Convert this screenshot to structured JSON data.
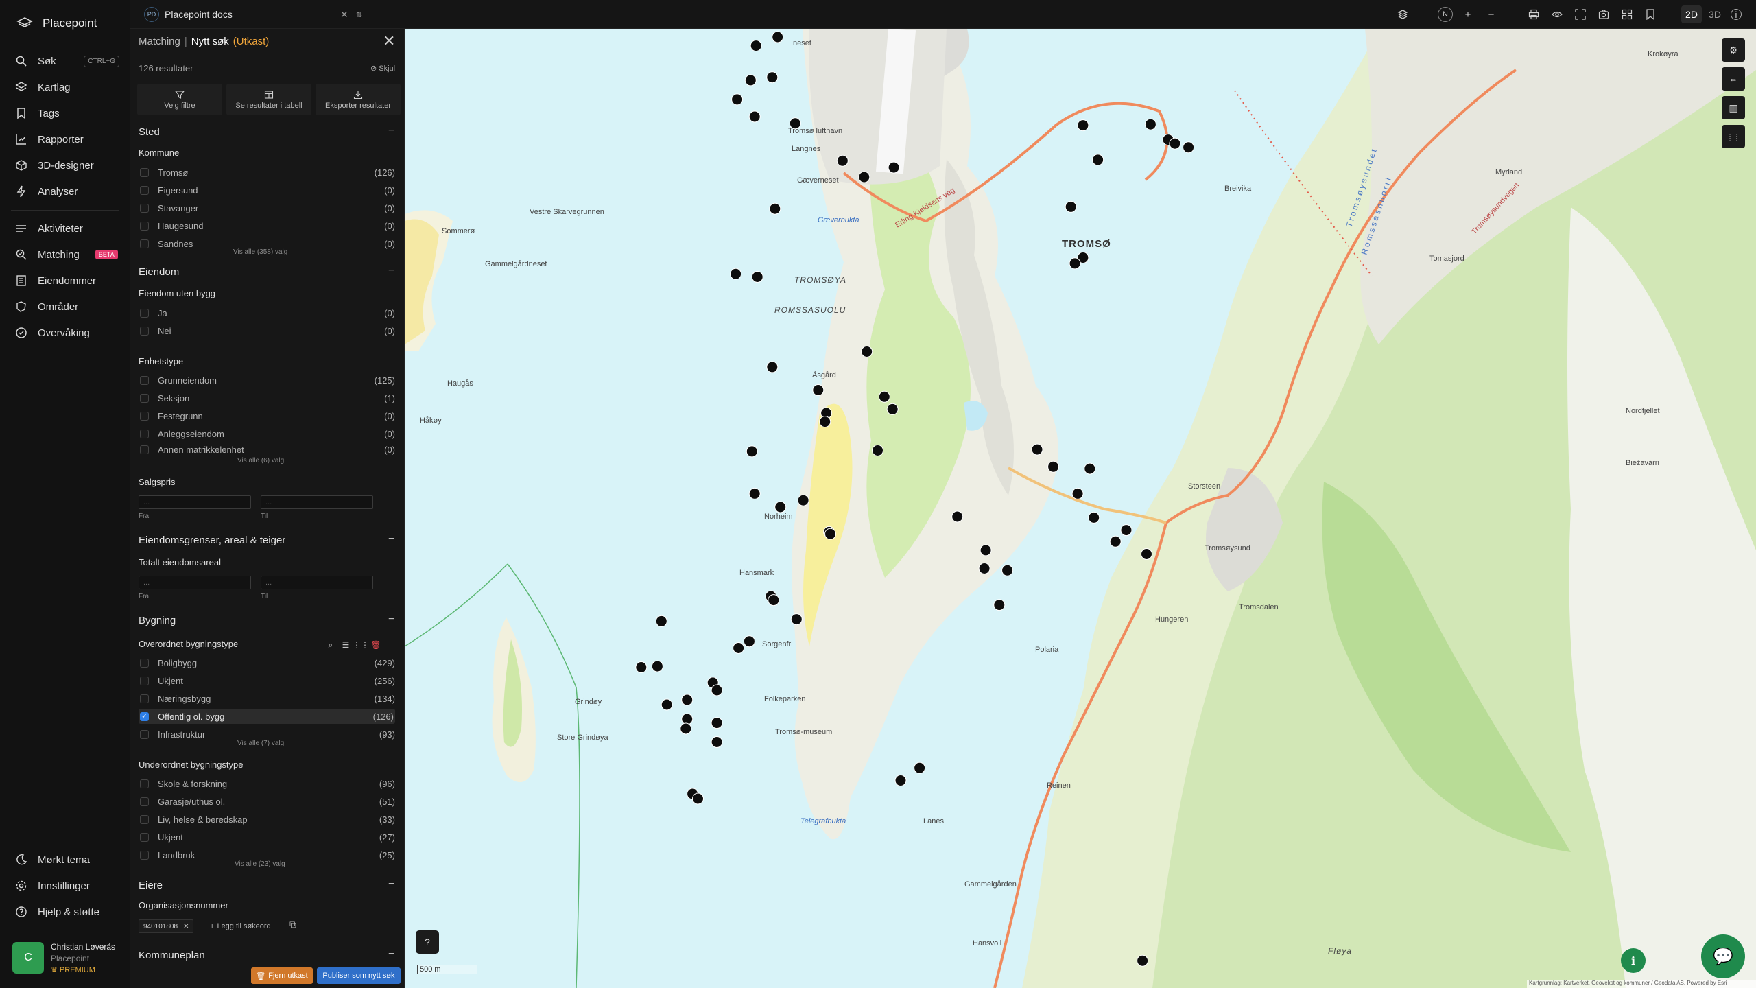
{
  "app": {
    "name": "Placepoint"
  },
  "nav": {
    "items": [
      {
        "label": "Søk",
        "shortcut": "CTRL+G",
        "icon": "search-icon"
      },
      {
        "label": "Kartlag",
        "icon": "layers-icon"
      },
      {
        "label": "Tags",
        "icon": "bookmark-icon"
      },
      {
        "label": "Rapporter",
        "icon": "chart-icon"
      },
      {
        "label": "3D-designer",
        "icon": "cube-icon"
      },
      {
        "label": "Analyser",
        "icon": "bolt-icon"
      },
      {
        "label": "Aktiviteter",
        "icon": "activity-icon"
      },
      {
        "label": "Matching",
        "badge": "BETA",
        "icon": "match-icon"
      },
      {
        "label": "Eiendommer",
        "icon": "building-icon"
      },
      {
        "label": "Områder",
        "icon": "area-icon"
      },
      {
        "label": "Overvåking",
        "icon": "monitor-icon"
      }
    ],
    "bottom": [
      {
        "label": "Mørkt tema",
        "icon": "moon-icon"
      },
      {
        "label": "Innstillinger",
        "icon": "gear-icon"
      },
      {
        "label": "Hjelp & støtte",
        "icon": "help-icon"
      }
    ],
    "user": {
      "initial": "C",
      "name": "Christian Løverås",
      "org": "Placepoint",
      "plan": "PREMIUM"
    }
  },
  "topbar": {
    "tab": {
      "badge": "PD",
      "title": "Placepoint docs"
    },
    "view_modes": [
      "2D",
      "3D"
    ],
    "active_mode": "2D",
    "compass": "N"
  },
  "panel": {
    "breadcrumb": {
      "section": "Matching",
      "separator": "|",
      "title": "Nytt søk",
      "status": "(Utkast)"
    },
    "results": "126 resultater",
    "hide_label": "Skjul",
    "actions": [
      {
        "label": "Velg filtre",
        "icon": "filter-icon"
      },
      {
        "label": "Se resultater i tabell",
        "icon": "table-icon"
      },
      {
        "label": "Eksporter resultater",
        "icon": "download-icon"
      }
    ],
    "sted": {
      "title": "Sted",
      "kommune": {
        "title": "Kommune",
        "options": [
          {
            "label": "Tromsø",
            "count": "(126)"
          },
          {
            "label": "Eigersund",
            "count": "(0)"
          },
          {
            "label": "Stavanger",
            "count": "(0)"
          },
          {
            "label": "Haugesund",
            "count": "(0)"
          },
          {
            "label": "Sandnes",
            "count": "(0)"
          }
        ],
        "more": "Vis alle (358) valg"
      }
    },
    "eiendom": {
      "title": "Eiendom",
      "uten_bygg": {
        "title": "Eiendom uten bygg",
        "options": [
          {
            "label": "Ja",
            "count": "(0)"
          },
          {
            "label": "Nei",
            "count": "(0)"
          }
        ]
      },
      "enhetstype": {
        "title": "Enhetstype",
        "options": [
          {
            "label": "Grunneiendom",
            "count": "(125)"
          },
          {
            "label": "Seksjon",
            "count": "(1)"
          },
          {
            "label": "Festegrunn",
            "count": "(0)"
          },
          {
            "label": "Anleggseiendom",
            "count": "(0)"
          },
          {
            "label": "Annen matrikkelenhet",
            "count": "(0)"
          }
        ],
        "more": "Vis alle (6) valg"
      },
      "salgspris": {
        "title": "Salgspris",
        "from_label": "Fra",
        "to_label": "Til",
        "from_placeholder": "...",
        "to_placeholder": "..."
      }
    },
    "grenser": {
      "title": "Eiendomsgrenser, areal & teiger",
      "areal": {
        "title": "Totalt eiendomsareal",
        "from_label": "Fra",
        "to_label": "Til",
        "from_placeholder": "...",
        "to_placeholder": "..."
      }
    },
    "bygning": {
      "title": "Bygning",
      "overordnet": {
        "title": "Overordnet bygningstype",
        "options": [
          {
            "label": "Boligbygg",
            "count": "(429)",
            "checked": false
          },
          {
            "label": "Ukjent",
            "count": "(256)",
            "checked": false
          },
          {
            "label": "Næringsbygg",
            "count": "(134)",
            "checked": false
          },
          {
            "label": "Offentlig ol. bygg",
            "count": "(126)",
            "checked": true
          },
          {
            "label": "Infrastruktur",
            "count": "(93)",
            "checked": false
          }
        ],
        "more": "Vis alle (7) valg"
      },
      "underordnet": {
        "title": "Underordnet bygningstype",
        "options": [
          {
            "label": "Skole & forskning",
            "count": "(96)"
          },
          {
            "label": "Garasje/uthus ol.",
            "count": "(51)"
          },
          {
            "label": "Liv, helse & beredskap",
            "count": "(33)"
          },
          {
            "label": "Ukjent",
            "count": "(27)"
          },
          {
            "label": "Landbruk",
            "count": "(25)"
          }
        ],
        "more": "Vis alle (23) valg"
      }
    },
    "eiere": {
      "title": "Eiere",
      "org": {
        "title": "Organisasjonsnummer",
        "chip": "940101808",
        "add_label": "Legg til søkeord"
      }
    },
    "kommuneplan": {
      "title": "Kommuneplan"
    },
    "buttons": {
      "remove": "Fjern utkast",
      "publish": "Publiser som nytt søk"
    }
  },
  "map": {
    "scale": "500 m",
    "attribution": "Kartgrunnlag: Kartverket, Geovekst og kommuner / Geodata AS, Powered by Esri",
    "labels": {
      "tromso": "TROMSØ",
      "tromsoya": "TROMSØYA",
      "romssasuolu": "ROMSSASUOLU",
      "tromsoysundet": "Tromsøysundet",
      "romssasnuorri": "Romssasnuorri",
      "gaeverbukta": "Gæverbukta",
      "telegrafbukta": "Telegrafbukta",
      "vestre": "Vestre Skarvegrunnen",
      "sommero": "Sommerø",
      "gammelgardneset": "Gammelgårdneset",
      "haugas": "Haugås",
      "hakoy": "Håkøy",
      "norheim": "Norheim",
      "hansmark": "Hansmark",
      "sorgenfri": "Sorgenfri",
      "folkeparken": "Folkeparken",
      "tromsomuseum": "Tromsø-museum",
      "lanes": "Lanes",
      "reinen": "Reinen",
      "gammelgarden": "Gammelgården",
      "hansvoll": "Hansvoll",
      "fjeva": "Fløya",
      "tromsdalen": "Tromsdalen",
      "hungeren": "Hungeren",
      "polaria": "Polaria",
      "storsteen": "Storsteen",
      "myrland": "Myrland",
      "krokeyra": "Krokøyra",
      "breivika": "Breivika",
      "langnes": "Langnes",
      "grindoy": "Grindøy",
      "store_grindoya": "Store Grindøya",
      "aasgard": "Åsgård",
      "tromso_lufthavn": "Tromsø lufthavn",
      "tomasjord": "Tomasjord",
      "bisvarri": "Biežavárri",
      "nordfjellet": "Nordfjellet",
      "erling": "Erling Kjeldsens veg",
      "tromsoysundvegen": "Tromsøysundvegen",
      "tromsoysund": "Tromsøysund",
      "gaevervenet": "Gæverneset",
      "neset": "neset",
      "bjorkeli": "Fløya"
    },
    "markers": [
      [
        0.26,
        0.009
      ],
      [
        0.276,
        0.0
      ],
      [
        0.256,
        0.045
      ],
      [
        0.272,
        0.042
      ],
      [
        0.246,
        0.065
      ],
      [
        0.259,
        0.083
      ],
      [
        0.289,
        0.09
      ],
      [
        0.324,
        0.129
      ],
      [
        0.34,
        0.146
      ],
      [
        0.362,
        0.136
      ],
      [
        0.274,
        0.179
      ],
      [
        0.245,
        0.247
      ],
      [
        0.261,
        0.25
      ],
      [
        0.272,
        0.344
      ],
      [
        0.306,
        0.368
      ],
      [
        0.342,
        0.328
      ],
      [
        0.355,
        0.375
      ],
      [
        0.361,
        0.388
      ],
      [
        0.312,
        0.392
      ],
      [
        0.311,
        0.401
      ],
      [
        0.35,
        0.431
      ],
      [
        0.257,
        0.432
      ],
      [
        0.259,
        0.476
      ],
      [
        0.278,
        0.49
      ],
      [
        0.295,
        0.483
      ],
      [
        0.314,
        0.516
      ],
      [
        0.315,
        0.518
      ],
      [
        0.271,
        0.583
      ],
      [
        0.273,
        0.587
      ],
      [
        0.29,
        0.607
      ],
      [
        0.255,
        0.63
      ],
      [
        0.247,
        0.637
      ],
      [
        0.19,
        0.609
      ],
      [
        0.175,
        0.657
      ],
      [
        0.228,
        0.673
      ],
      [
        0.231,
        0.681
      ],
      [
        0.194,
        0.696
      ],
      [
        0.209,
        0.691
      ],
      [
        0.209,
        0.711
      ],
      [
        0.208,
        0.721
      ],
      [
        0.231,
        0.715
      ],
      [
        0.231,
        0.735
      ],
      [
        0.187,
        0.656
      ],
      [
        0.213,
        0.789
      ],
      [
        0.217,
        0.794
      ],
      [
        0.381,
        0.762
      ],
      [
        0.367,
        0.775
      ],
      [
        0.468,
        0.43
      ],
      [
        0.48,
        0.448
      ],
      [
        0.507,
        0.45
      ],
      [
        0.51,
        0.501
      ],
      [
        0.498,
        0.476
      ],
      [
        0.534,
        0.514
      ],
      [
        0.43,
        0.535
      ],
      [
        0.409,
        0.5
      ],
      [
        0.429,
        0.554
      ],
      [
        0.446,
        0.556
      ],
      [
        0.526,
        0.526
      ],
      [
        0.549,
        0.539
      ],
      [
        0.44,
        0.592
      ],
      [
        0.502,
        0.092
      ],
      [
        0.552,
        0.091
      ],
      [
        0.565,
        0.107
      ],
      [
        0.57,
        0.111
      ],
      [
        0.58,
        0.115
      ],
      [
        0.513,
        0.128
      ],
      [
        0.493,
        0.177
      ],
      [
        0.502,
        0.23
      ],
      [
        0.496,
        0.236
      ],
      [
        0.546,
        0.963
      ]
    ]
  }
}
